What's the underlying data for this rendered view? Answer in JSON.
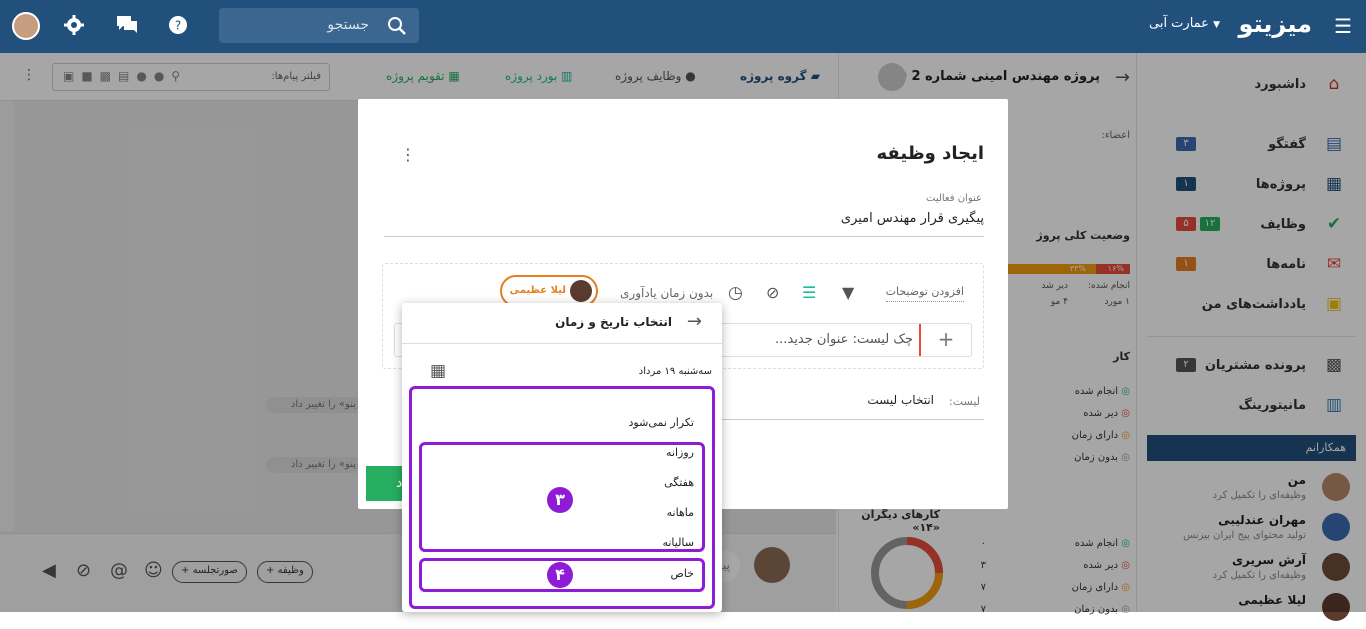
{
  "topbar": {
    "brand": "میزیتو",
    "workspace": "عمارت آبی",
    "search_placeholder": "جستجو"
  },
  "sidebar": {
    "items": [
      {
        "label": "داشبورد",
        "icon": "home-icon",
        "color": "#c0392b"
      },
      {
        "label": "گفتگو",
        "icon": "chat-icon",
        "badge": "۳",
        "badge_color": "#3b6ab0"
      },
      {
        "label": "پروژه‌ها",
        "icon": "projects-icon",
        "badge": "۱",
        "badge_color": "#22507c"
      },
      {
        "label": "وظایف",
        "icon": "tasks-icon",
        "badge": "۱۲",
        "badge_color": "#27ae60",
        "badge2": "۵",
        "badge2_color": "#e74c3c"
      },
      {
        "label": "نامه‌ها",
        "icon": "mail-icon",
        "badge": "۱",
        "badge_color": "#e67e22"
      },
      {
        "label": "یادداشت‌های من",
        "icon": "notes-icon"
      },
      {
        "label": "پرونده مشتریان",
        "icon": "customers-icon",
        "badge": "۲",
        "badge_color": "#555"
      },
      {
        "label": "مانیتورینگ",
        "icon": "monitoring-icon"
      }
    ],
    "colleagues_header": "همکارانم",
    "colleagues": [
      {
        "name": "من",
        "status": "وظیفه‌ای را تکمیل کرد"
      },
      {
        "name": "مهران عندلیبی",
        "status": "تولید محتوای پیج ایران بیزنس"
      },
      {
        "name": "آرش سریری",
        "status": "وظیفه‌ای را تکمیل کرد"
      },
      {
        "name": "لیلا عظیمی",
        "status": ""
      }
    ]
  },
  "project": {
    "title": "پروژه مهندس امینی شماره 2",
    "members_label": "اعضاء:",
    "status_title": "وضعیت کلی پروژ",
    "stats": [
      "۱۶%",
      "۳۳%"
    ],
    "stat_labels": [
      "انجام شده:",
      "دیر شد"
    ],
    "stat_values": [
      "۱ مورد",
      "۴ مو"
    ],
    "my_tasks_title": "کار",
    "my_tasks": [
      "انجام شده",
      "دیر شده",
      "دارای زمان",
      "بدون زمان"
    ],
    "others_title": "کارهای دیگران «۱۴»",
    "others": [
      {
        "label": "انجام شده",
        "value": "۰"
      },
      {
        "label": "دیر شده",
        "value": "۳"
      },
      {
        "label": "دارای زمان",
        "value": "۷"
      },
      {
        "label": "بدون زمان",
        "value": "۷"
      }
    ]
  },
  "chatbar": {
    "tabs": [
      "گروه پروژه",
      "وظایف پروژه",
      "بورد پروژه",
      "تقویم پروژه"
    ],
    "filter_placeholder": "فیلتر پیام‌ها:",
    "messages": [
      "ینو» را تغییر داد",
      "ینو» را تغییر داد"
    ],
    "input_stub": "پیا",
    "chip_task": "+ وظیفه",
    "chip_meeting": "+ صورتجلسه"
  },
  "modal": {
    "title": "ایجاد وظیفه",
    "activity_label": "عنوان فعالیت",
    "activity_value": "پیگیری قرار مهندس امیری",
    "add_description": "افزودن توضیحات",
    "reminder": "بدون زمان یادآوری",
    "assignee": "لیلا عظیمی",
    "checklist_placeholder": "چک لیست: عنوان جدید...",
    "list_label": "لیست:",
    "list_value": "انتخاب لیست",
    "save_stub": "د"
  },
  "picker": {
    "title": "انتخاب تاریخ و زمان",
    "date": "سه‌شنبه ۱۹ مرداد",
    "options": [
      "تکرار نمی‌شود",
      "روزانه",
      "هفتگی",
      "ماهانه",
      "سالیانه",
      "خاص"
    ],
    "annotation_3": "۳",
    "annotation_4": "۴",
    "highlight_color": "#8e1bd6"
  }
}
